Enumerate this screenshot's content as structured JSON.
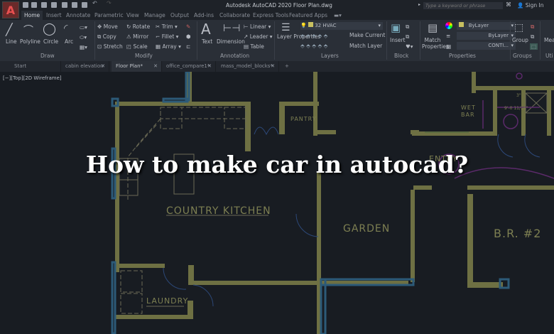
{
  "app": {
    "logo": "A",
    "title": "Autodesk AutoCAD 2020   Floor Plan.dwg",
    "search_placeholder": "Type a keyword or phrase",
    "sign_in": "Sign In"
  },
  "menu_tabs": [
    "Home",
    "Insert",
    "Annotate",
    "Parametric",
    "View",
    "Manage",
    "Output",
    "Add-ins",
    "Collaborate",
    "Express Tools",
    "Featured Apps"
  ],
  "ribbon": {
    "draw": {
      "label": "Draw",
      "tools": [
        "Line",
        "Polyline",
        "Circle",
        "Arc"
      ]
    },
    "modify": {
      "label": "Modify",
      "tools": [
        "Move",
        "Rotate",
        "Trim",
        "Copy",
        "Mirror",
        "Fillet",
        "Stretch",
        "Scale",
        "Array"
      ]
    },
    "annotation": {
      "label": "Annotation",
      "tools": [
        "Text",
        "Dimension",
        "Linear",
        "Leader",
        "Table"
      ]
    },
    "layers": {
      "label": "Layers",
      "tools": [
        "Layer Properties",
        "Make Current",
        "Match Layer"
      ],
      "current_layer": "32 HVAC",
      "layer_color": "#c8c060"
    },
    "block": {
      "label": "Block",
      "tools": [
        "Insert"
      ]
    },
    "properties": {
      "label": "Properties",
      "tools": [
        "Match Properties"
      ],
      "color": "ByLayer",
      "lineweight": "ByLayer",
      "linetype": "CONTI..."
    },
    "groups": {
      "label": "Groups",
      "tools": [
        "Group"
      ]
    },
    "utilities": {
      "label": "Uti",
      "tools": [
        "Mea"
      ]
    }
  },
  "file_tabs": [
    {
      "label": "Start",
      "active": false
    },
    {
      "label": "cabin elevation",
      "active": false
    },
    {
      "label": "Floor Plan*",
      "active": true
    },
    {
      "label": "office_compare1*",
      "active": false
    },
    {
      "label": "mass_model_blocks*",
      "active": false
    }
  ],
  "viewport_label": "[−][Top][2D Wireframe]",
  "drawing": {
    "rooms": [
      "COUNTRY KITCHEN",
      "GARDEN",
      "PANTRY",
      "LAUNDRY",
      "WET",
      "BAR",
      "ENTRY",
      "B.R. #2"
    ],
    "dimensions": [
      "9'-0 11/16\"",
      "3\""
    ]
  },
  "overlay_title": "How to make car in autocad?"
}
